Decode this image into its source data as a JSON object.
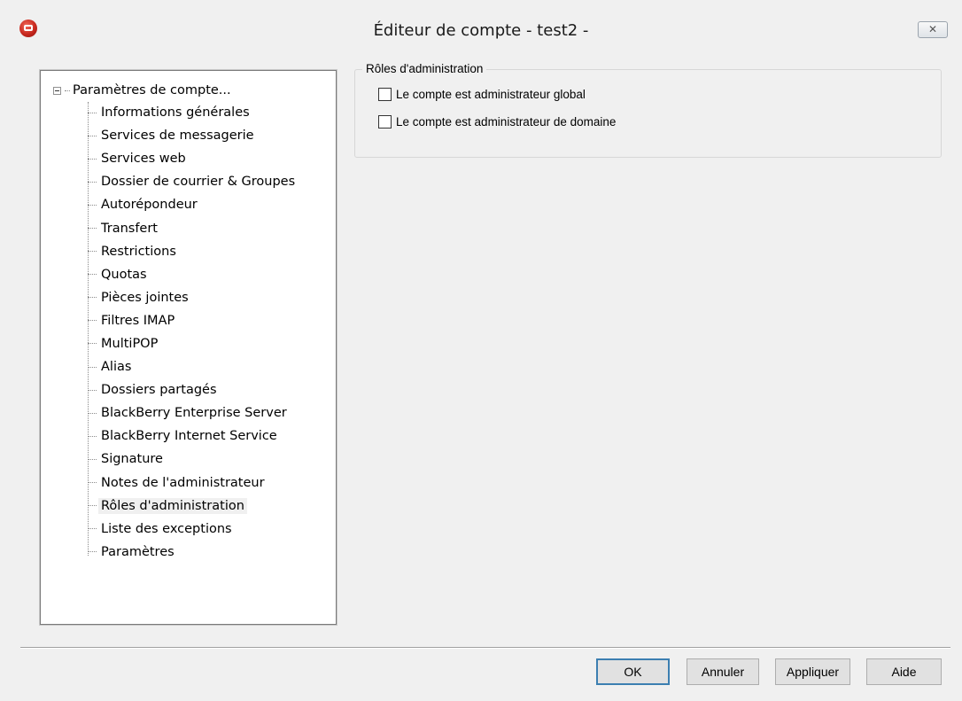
{
  "window": {
    "title": "Éditeur de compte - test2 -",
    "close_glyph": "✕",
    "app_icon": "mdaemon-icon"
  },
  "tree": {
    "root_label": "Paramètres de compte...",
    "items": [
      {
        "label": "Informations générales"
      },
      {
        "label": "Services de messagerie"
      },
      {
        "label": "Services web"
      },
      {
        "label": "Dossier de courrier & Groupes"
      },
      {
        "label": "Autorépondeur"
      },
      {
        "label": "Transfert"
      },
      {
        "label": "Restrictions"
      },
      {
        "label": "Quotas"
      },
      {
        "label": "Pièces jointes"
      },
      {
        "label": "Filtres IMAP"
      },
      {
        "label": "MultiPOP"
      },
      {
        "label": "Alias"
      },
      {
        "label": "Dossiers partagés"
      },
      {
        "label": "BlackBerry Enterprise Server"
      },
      {
        "label": "BlackBerry Internet Service"
      },
      {
        "label": "Signature"
      },
      {
        "label": "Notes de l'administrateur"
      },
      {
        "label": "Rôles d'administration",
        "selected": true
      },
      {
        "label": "Liste des exceptions"
      },
      {
        "label": "Paramètres"
      }
    ]
  },
  "panel": {
    "group_title": "Rôles d'administration",
    "checkboxes": [
      {
        "label": "Le compte est administrateur global",
        "checked": false
      },
      {
        "label": "Le compte est administrateur de domaine",
        "checked": false
      }
    ]
  },
  "buttons": {
    "ok": "OK",
    "cancel": "Annuler",
    "apply": "Appliquer",
    "help": "Aide"
  }
}
